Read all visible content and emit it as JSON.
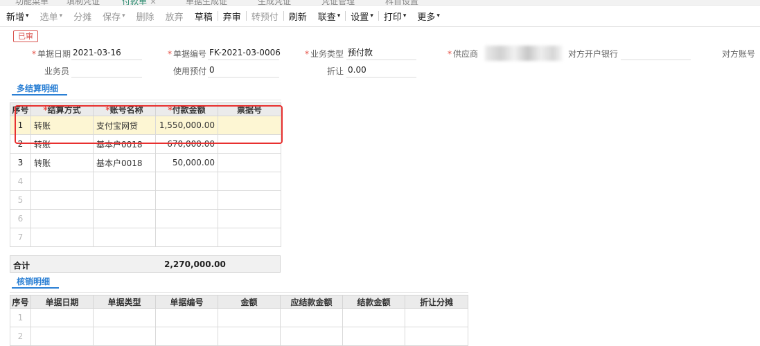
{
  "tabs": [
    {
      "label": "功能菜单",
      "active": false
    },
    {
      "label": "填制凭证",
      "active": false
    },
    {
      "label": "付款单",
      "active": true
    },
    {
      "label": "单据生成证",
      "active": false
    },
    {
      "label": "生成凭证",
      "active": false
    },
    {
      "label": "凭证管理",
      "active": false
    },
    {
      "label": "科目设置",
      "active": false
    }
  ],
  "tab_close": "×",
  "toolbar": {
    "add": "新增",
    "select": "选单",
    "allocate": "分摊",
    "save": "保存",
    "delete": "删除",
    "discard": "放弃",
    "draft": "草稿",
    "unaudit": "弃审",
    "to_prepay": "转预付",
    "refresh": "刷新",
    "linked": "联查",
    "settings": "设置",
    "print": "打印",
    "more": "更多",
    "chevron": "▾"
  },
  "status_badge": "已审",
  "form": {
    "date_label": "单据日期",
    "date_value": "2021-03-16",
    "number_label": "单据编号",
    "number_value": "FK-2021-03-0006",
    "biztype_label": "业务类型",
    "biztype_value": "预付款",
    "supplier_label": "供应商",
    "bank_label": "对方开户银行",
    "bank_value": "",
    "account_label": "对方账号",
    "clerk_label": "业务员",
    "clerk_value": "",
    "prepay_label": "使用预付",
    "prepay_value": "0",
    "discount_label": "折让",
    "discount_value": "0.00"
  },
  "settlement": {
    "title": "多结算明细",
    "headers": [
      "序号",
      "结算方式",
      "账号名称",
      "付款金额",
      "票据号"
    ],
    "rows": [
      {
        "idx": "1",
        "method": "转账",
        "account": "支付宝网贷",
        "amount": "1,550,000.00",
        "bill": ""
      },
      {
        "idx": "2",
        "method": "转账",
        "account": "基本户0018",
        "amount": "670,000.00",
        "bill": ""
      },
      {
        "idx": "3",
        "method": "转账",
        "account": "基本户0018",
        "amount": "50,000.00",
        "bill": ""
      },
      {
        "idx": "4",
        "method": "",
        "account": "",
        "amount": "",
        "bill": ""
      },
      {
        "idx": "5",
        "method": "",
        "account": "",
        "amount": "",
        "bill": ""
      },
      {
        "idx": "6",
        "method": "",
        "account": "",
        "amount": "",
        "bill": ""
      },
      {
        "idx": "7",
        "method": "",
        "account": "",
        "amount": "",
        "bill": ""
      }
    ],
    "total_label": "合计",
    "total_amount": "2,270,000.00"
  },
  "writeoff": {
    "title": "核销明细",
    "headers": [
      "序号",
      "单据日期",
      "单据类型",
      "单据编号",
      "金额",
      "应结款金额",
      "结款金额",
      "折让分摊"
    ],
    "rows": [
      {
        "idx": "1"
      },
      {
        "idx": "2"
      }
    ]
  },
  "colors": {
    "accent": "#2a7fd4",
    "required": "#e54d42",
    "selected_row": "#fdf6d3",
    "highlight": "#e8302f",
    "active_tab": "#2b8a6e"
  }
}
